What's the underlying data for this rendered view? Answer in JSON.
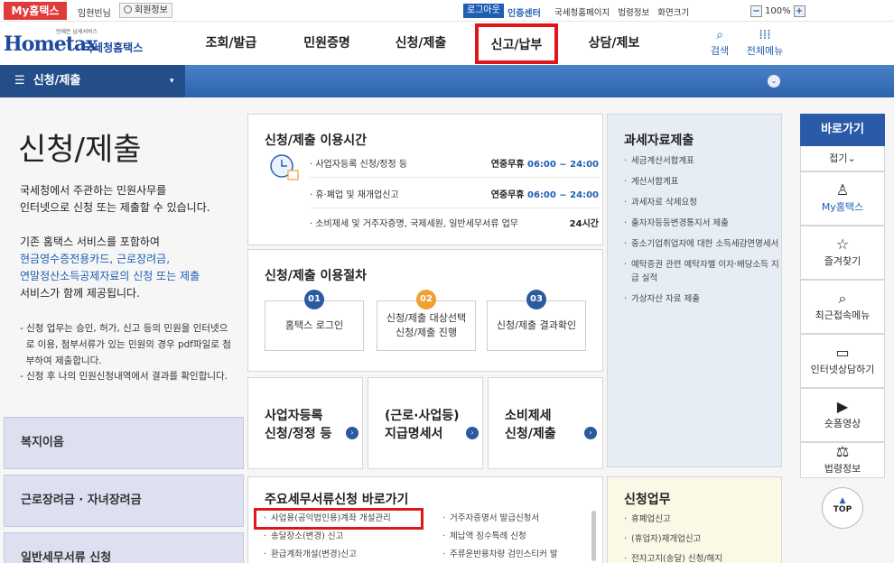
{
  "topbar": {
    "my_hometax": "My홈택스",
    "username": "임현빈님",
    "member_info": "회원정보",
    "logout": "로그아웃",
    "auth_center": "인증센터",
    "links": [
      "국세청홈페이지",
      "법령정보",
      "화면크기"
    ],
    "zoom_minus": "−",
    "zoom_value": "100%",
    "zoom_plus": "+"
  },
  "header": {
    "logo_small": "언제든 납세서비스",
    "logo_text": "Hometax",
    "logo_korean": "국세청홈택스",
    "nav": [
      {
        "label": "조회/발급"
      },
      {
        "label": "민원증명"
      },
      {
        "label": "신청/제출"
      },
      {
        "label": "신고/납부"
      },
      {
        "label": "상담/제보"
      }
    ],
    "search_label": "검색",
    "allmenu_label": "전체메뉴"
  },
  "subbar": {
    "menu_icon": "☰",
    "title": "신청/제출",
    "dropdown_icon": "▾",
    "expand_icon": "⌄"
  },
  "intro": {
    "title": "신청/제출",
    "p1_line1": "국세청에서 주관하는 민원사무를",
    "p1_line2": "인터넷으로 신청 또는 제출할 수 있습니다.",
    "p2_line1": "기존 홈택스 서비스를 포함하여",
    "p2_line2": "현금영수증전용카드, 근로장려금,",
    "p2_line3": "연말정산소득공제자료의 신청 또는 제출",
    "p2_line4": "서비스가 함께 제공됩니다.",
    "note1_line1": "- 신청 업무는 승인, 허가, 신고 등의 민원을 인터넷으",
    "note1_line2": "로 이용, 첨부서류가 있는 민원의 경우 pdf파일로 첨",
    "note1_line3": "부하여 제출합니다.",
    "note2": "- 신청 후 나의 민원신청내역에서 결과를 확인합니다."
  },
  "left_menu": [
    "복지이음",
    "근로장려금 · 자녀장려금",
    "일반세무서류 신청"
  ],
  "usage_time": {
    "title": "신청/제출 이용시간",
    "rows": [
      {
        "label": "· 사업자등록 신청/정정 등",
        "days": "연중무휴",
        "time": "06:00 ~ 24:00"
      },
      {
        "label": "· 휴·폐업 및 재개업신고",
        "days": "연중무휴",
        "time": "06:00 ~ 24:00"
      },
      {
        "label": "· 소비제세 및 거주자증명, 국제세원, 일반세무서류 업무",
        "days": "",
        "time": "24시간"
      }
    ]
  },
  "procedure": {
    "title": "신청/제출 이용절차",
    "steps": [
      {
        "num": "01",
        "line1": "홈택스 로그인",
        "line2": ""
      },
      {
        "num": "02",
        "line1": "신청/제출 대상선택",
        "line2": "신청/제출 진행"
      },
      {
        "num": "03",
        "line1": "신청/제출 결과확인",
        "line2": ""
      }
    ]
  },
  "tiles": [
    {
      "line1": "사업자등록",
      "line2": "신청/정정 등"
    },
    {
      "line1": "(근로·사업등)",
      "line2": "지급명세서"
    },
    {
      "line1": "소비제세",
      "line2": "신청/제출"
    }
  ],
  "main_docs": {
    "title": "주요세무서류신청 바로가기",
    "col1": [
      "사업용(공익법인용)계좌 개설관리",
      "송달장소(변경) 신고",
      "환급계좌개설(변경)신고"
    ],
    "col2": [
      "거주자증명서 발급신청서",
      "체납액 징수특례 신청",
      "주류운반용차량 검인스티커 발"
    ]
  },
  "tax_data": {
    "title": "과세자료제출",
    "items": [
      "세금계산서합계표",
      "계산서합계표",
      "과세자료 삭제요청",
      "출자자등등변경통지서 제출",
      "중소기업취업자에 대한 소득세감면명세서",
      "예탁증권 관련 예탁자별 이자·배당소득 지급 실적",
      "가상자산 자료 제출"
    ]
  },
  "app_work": {
    "title": "신청업무",
    "items": [
      "휴폐업신고",
      "(휴업자)재개업신고",
      "전자고지(송달) 신청/해지"
    ]
  },
  "quick": {
    "title": "바로가기",
    "fold": "접기",
    "fold_icon": "⌄",
    "items": [
      {
        "icon": "person-icon",
        "glyph": "♙",
        "label": "My홈택스"
      },
      {
        "icon": "star-icon",
        "glyph": "☆",
        "label": "즐겨찾기"
      },
      {
        "icon": "recent-icon",
        "glyph": "⌕",
        "label": "최근접속메뉴"
      },
      {
        "icon": "monitor-icon",
        "glyph": "▭",
        "label": "인터넷상담하기"
      },
      {
        "icon": "play-icon",
        "glyph": "▶",
        "label": "숏폼영상"
      },
      {
        "icon": "gavel-icon",
        "glyph": "⚖",
        "label": "법령정보"
      }
    ],
    "top_icon": "▲",
    "top": "TOP"
  },
  "colors": {
    "accent": "#1e5fb4",
    "brand_red": "#e0161b",
    "step1": "#2c5aa0",
    "step2": "#f0a030",
    "step3": "#2c5aa0"
  }
}
